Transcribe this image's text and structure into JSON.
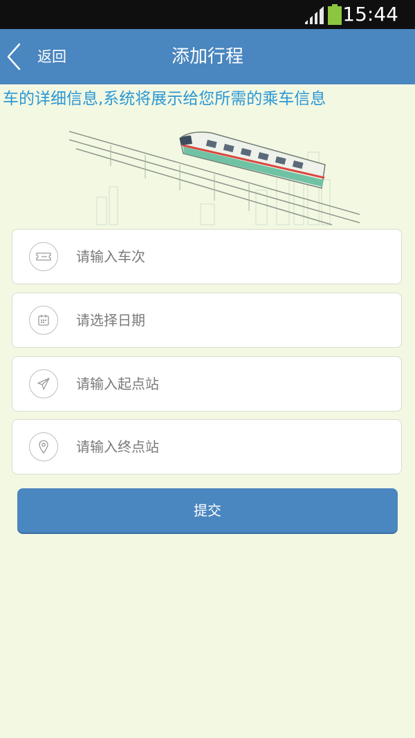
{
  "status_bar": {
    "time": "15:44",
    "battery_color": "#8cc63f"
  },
  "header": {
    "back_label": "返回",
    "title": "添加行程"
  },
  "marquee_text": "车的详细信息,系统将展示给您所需的乘车信息",
  "form": {
    "fields": [
      {
        "placeholder": "请输入车次",
        "icon": "ticket-icon"
      },
      {
        "placeholder": "请选择日期",
        "icon": "calendar-icon"
      },
      {
        "placeholder": "请输入起点站",
        "icon": "paper-plane-icon"
      },
      {
        "placeholder": "请输入终点站",
        "icon": "location-pin-icon"
      }
    ],
    "submit_label": "提交"
  },
  "colors": {
    "accent": "#4a86bf",
    "background": "#f3f8e2",
    "marquee": "#2b97d6"
  }
}
